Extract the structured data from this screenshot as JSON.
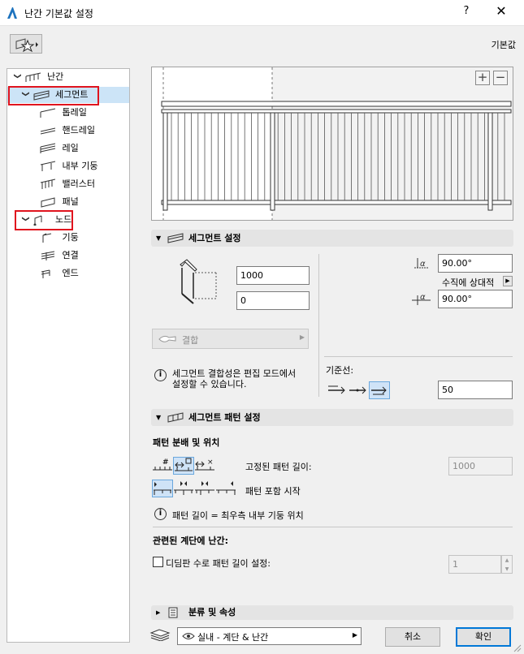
{
  "window": {
    "title": "난간 기본값 설정",
    "help": "?",
    "close": "✕"
  },
  "toolbar": {
    "default_label": "기본값"
  },
  "tree": {
    "root": "난간",
    "segment": "세그먼트",
    "segment_children": [
      "톱레일",
      "핸드레일",
      "레일",
      "내부 기둥",
      "밸러스터",
      "패널"
    ],
    "node": "노드",
    "node_children": [
      "기둥",
      "연결",
      "엔드"
    ]
  },
  "segment_settings": {
    "header": "세그먼트 설정",
    "height_value": "1000",
    "offset_value": "0",
    "angle_top_value": "90.00°",
    "relative_label": "수직에 상대적",
    "angle_bottom_value": "90.00°",
    "join_label": "결합",
    "info_text_line1": "세그먼트 결합성은 편집 모드에서",
    "info_text_line2": "설정할 수 있습니다.",
    "baseline_label": "기준선:",
    "baseline_value": "50"
  },
  "pattern_settings": {
    "header": "세그먼트 패턴 설정",
    "distribution_label": "패턴 분배 및 위치",
    "fixed_length_label": "고정된 패턴 길이:",
    "fixed_length_value": "1000",
    "pattern_start_label": "패턴 포함 시작",
    "info_text": "패턴 길이 = 최우측 내부 기둥 위치",
    "related_stair_label": "관련된 계단에 난간:",
    "tread_checkbox_label": "디딤판 수로 패턴 길이 설정:",
    "tread_value": "1"
  },
  "classification": {
    "header": "분류 및 속성"
  },
  "footer": {
    "layer_value": "실내 - 계단 & 난간",
    "cancel": "취소",
    "ok": "확인"
  },
  "colors": {
    "selection": "#cce4f7",
    "highlight_box": "#e0141e",
    "primary_border": "#0078d7"
  }
}
